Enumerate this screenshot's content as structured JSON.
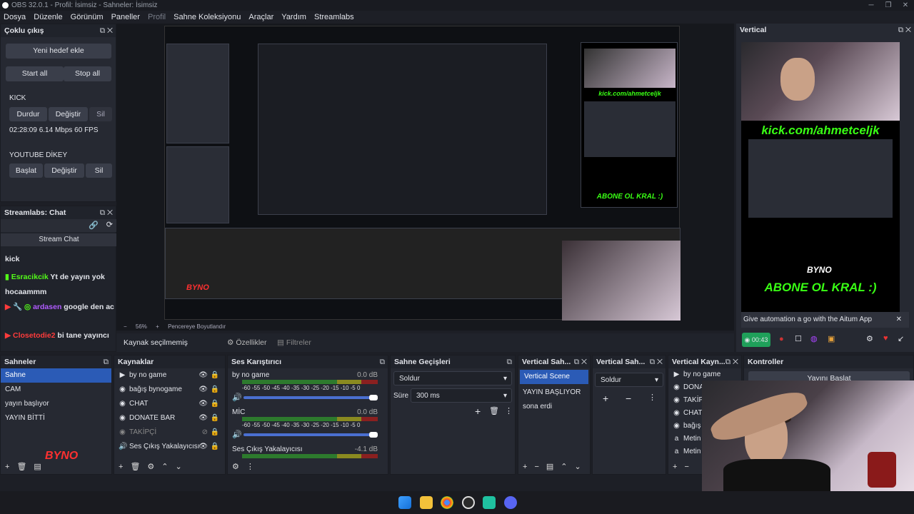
{
  "window": {
    "title": "OBS 32.0.1 - Profil: İsimsiz - Sahneler: İsimsiz"
  },
  "menu": [
    "Dosya",
    "Düzenle",
    "Görünüm",
    "Paneller",
    "Profil",
    "Sahne Koleksiyonu",
    "Araçlar",
    "Yardım",
    "Streamlabs"
  ],
  "multi": {
    "title": "Çoklu çıkış",
    "new_target": "Yeni hedef ekle",
    "start_all": "Start all",
    "stop_all": "Stop all",
    "kick": {
      "name": "KICK",
      "stop": "Durdur",
      "change": "Değiştir",
      "delete": "Sil",
      "stats": "02:28:09  6.14 Mbps  60 FPS"
    },
    "yt": {
      "name": "YOUTUBE DİKEY",
      "start": "Başlat",
      "change": "Değiştir",
      "delete": "Sil"
    }
  },
  "chat": {
    "title": "Streamlabs: Chat",
    "header": "Stream Chat",
    "lines": [
      {
        "user": "",
        "text": "kick",
        "color": "#ffffff"
      },
      {
        "user": "Esracikcik",
        "text": " Yt de yayın yok hocaammm",
        "color": "#53fc18"
      },
      {
        "user": "ardasen",
        "text": " google den ac",
        "color": "#b05cff"
      },
      {
        "user": "Closetodie2",
        "text": " bi tane yayıncı",
        "color": "#ff3b3b"
      }
    ]
  },
  "preview": {
    "overlay_url": "kick.com/ahmetcelj​k",
    "overlay_sub": "ABONE OL KRAL :)",
    "byno": "BYNO",
    "zoom": "56%",
    "fit": "Pencereye Boyutlandır"
  },
  "toolbar": {
    "no_source": "Kaynak seçilmemiş",
    "props": "Özellikler",
    "filters": "Filtreler"
  },
  "vertical": {
    "title": "Vertical",
    "url": "kick.com/ahmetcelјk",
    "sub": "ABONE OL KRAL :)",
    "byno": "BYNO",
    "banner": "Give automation a go with the Aitum App",
    "timer": "00:43"
  },
  "scenes": {
    "title": "Sahneler",
    "items": [
      "Sahne",
      "CAM",
      "yayın başlıyor",
      "YAYIN BİTTİ"
    ]
  },
  "sources": {
    "title": "Kaynaklar",
    "items": [
      "by no game",
      "bağış bynogame",
      "CHAT",
      "DONATE BAR",
      "TAKİPÇİ",
      "Ses Çıkış Yakalayıcısı"
    ]
  },
  "mixer": {
    "title": "Ses Karıştırıcı",
    "channels": [
      {
        "name": "by no game",
        "db": "0.0 dB"
      },
      {
        "name": "MİC",
        "db": "0.0 dB"
      },
      {
        "name": "Ses Çıkış Yakalayıcısı",
        "db": "-4.1 dB"
      }
    ],
    "ticks": "-60 -55 -50 -45 -40 -35 -30 -25 -20 -15 -10 -5 0"
  },
  "transitions": {
    "title": "Sahne Geçişleri",
    "selected": "Soldur",
    "duration_label": "Süre",
    "duration": "300 ms"
  },
  "vscenes": {
    "title": "Vertical Sah...",
    "items": [
      "Vertical Scene",
      "YAYIN BAŞLIYOR",
      "sona erdi"
    ]
  },
  "vtrans": {
    "title": "Vertical Sah...",
    "selected": "Soldur"
  },
  "vsources": {
    "title": "Vertical Kayn...",
    "items": [
      "by no game",
      "DONA",
      "TAKİP",
      "CHAT",
      "bağış b",
      "Metin",
      "Metin"
    ]
  },
  "controls": {
    "title": "Kontroller",
    "start": "Yayını Başlat"
  }
}
